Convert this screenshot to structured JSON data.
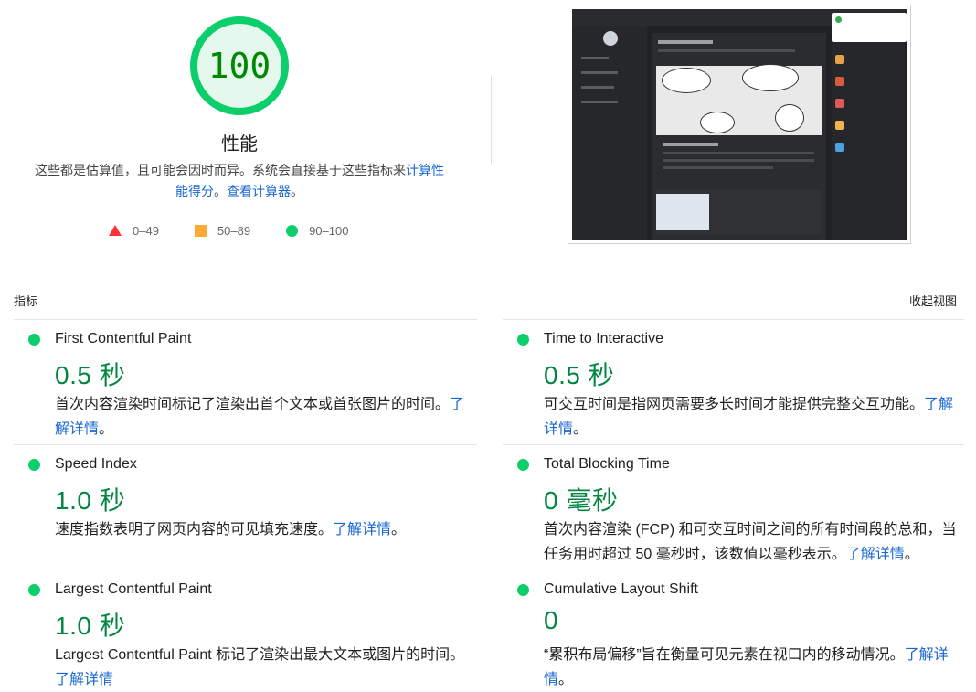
{
  "score": {
    "value": "100",
    "category_title": "性能",
    "description_text": "这些都是估算值，且可能会因时而异。系统会直接基于这些指标来",
    "description_link": "计算性能得分",
    "description_sep": "。",
    "calculator_link": "查看计算器",
    "calculator_end": "。",
    "color": "#0cce6b"
  },
  "legend": [
    {
      "shape": "triangle",
      "label": "0–49",
      "color": "#ff3333"
    },
    {
      "shape": "square",
      "label": "50–89",
      "color": "#ffaa33"
    },
    {
      "shape": "circle",
      "label": "90–100",
      "color": "#0cce6b"
    }
  ],
  "metrics_header": {
    "label": "指标",
    "toggle": "收起视图"
  },
  "learn_more": "了解详情",
  "metrics": [
    {
      "title": "First Contentful Paint",
      "value": "0.5 秒",
      "description": "首次内容渲染时间标记了渲染出首个文本或首张图片的时间。",
      "end": "。"
    },
    {
      "title": "Time to Interactive",
      "value": "0.5 秒",
      "description": "可交互时间是指网页需要多长时间才能提供完整交互功能。",
      "end": "。"
    },
    {
      "title": "Speed Index",
      "value": "1.0 秒",
      "description": "速度指数表明了网页内容的可见填充速度。",
      "end": "。"
    },
    {
      "title": "Total Blocking Time",
      "value": "0 毫秒",
      "description": "首次内容渲染 (FCP) 和可交互时间之间的所有时间段的总和，当任务用时超过 50 毫秒时，该数值以毫秒表示。",
      "end": "。"
    },
    {
      "title": "Largest Contentful Paint",
      "value": "1.0 秒",
      "description": "Largest Contentful Paint 标记了渲染出最大文本或图片的时间。",
      "end": ""
    },
    {
      "title": "Cumulative Layout Shift",
      "value": "0",
      "description": "“累积布局偏移”旨在衡量可见元素在视口内的移动情况。",
      "end": "。"
    }
  ]
}
